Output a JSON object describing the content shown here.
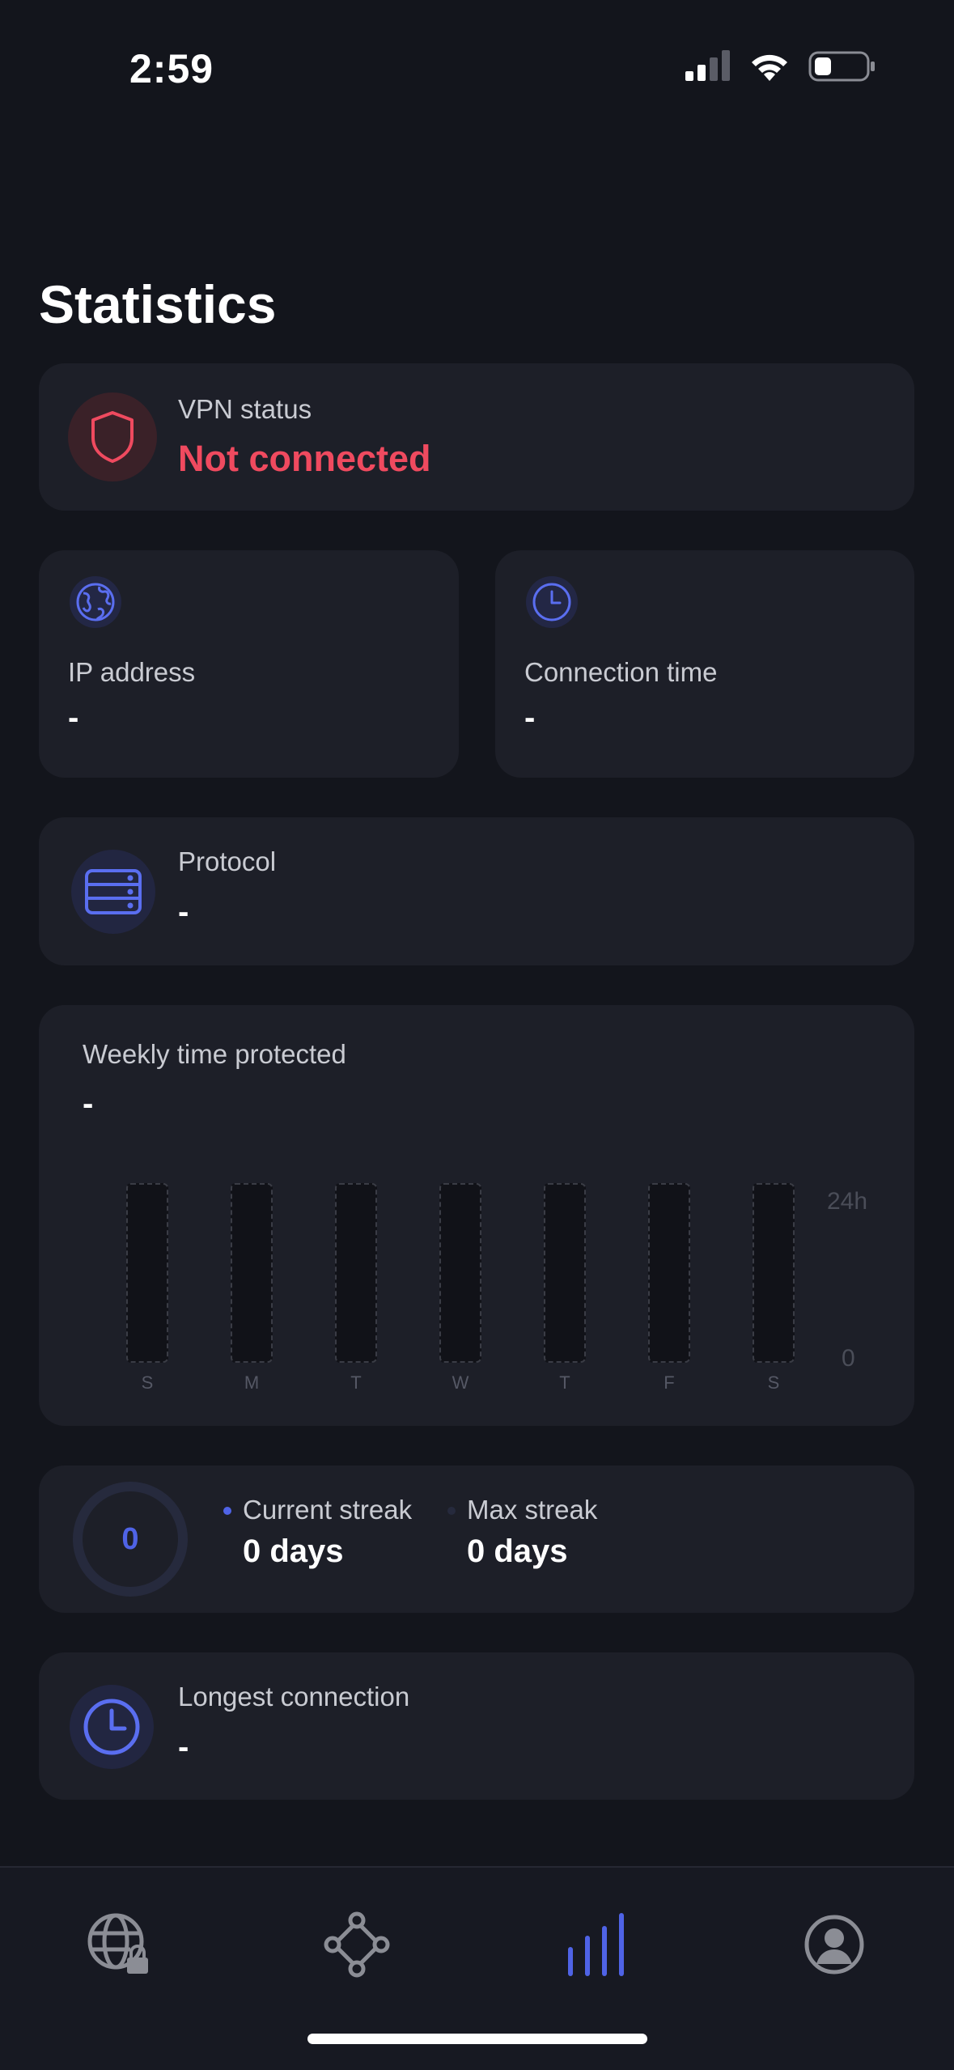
{
  "status_bar": {
    "time": "2:59"
  },
  "page": {
    "title": "Statistics"
  },
  "vpn_status": {
    "label": "VPN status",
    "value": "Not connected"
  },
  "ip_address": {
    "label": "IP address",
    "value": "-"
  },
  "connection_time": {
    "label": "Connection time",
    "value": "-"
  },
  "protocol": {
    "label": "Protocol",
    "value": "-"
  },
  "weekly": {
    "title": "Weekly time protected",
    "value": "-",
    "days": [
      "S",
      "M",
      "T",
      "W",
      "T",
      "F",
      "S"
    ],
    "axis_max": "24h",
    "axis_min": "0"
  },
  "streak": {
    "ring_value": "0",
    "current_label": "Current streak",
    "current_value": "0 days",
    "max_label": "Max streak",
    "max_value": "0 days"
  },
  "longest": {
    "label": "Longest connection",
    "value": "-"
  },
  "colors": {
    "accent": "#4f63e6",
    "danger": "#ef4a5f",
    "card": "#1d1f28",
    "background": "#13151c"
  },
  "tabbar": {
    "items": [
      {
        "icon": "globe-lock-icon"
      },
      {
        "icon": "network-nodes-icon"
      },
      {
        "icon": "statistics-bars-icon",
        "active": true
      },
      {
        "icon": "profile-icon"
      }
    ]
  }
}
